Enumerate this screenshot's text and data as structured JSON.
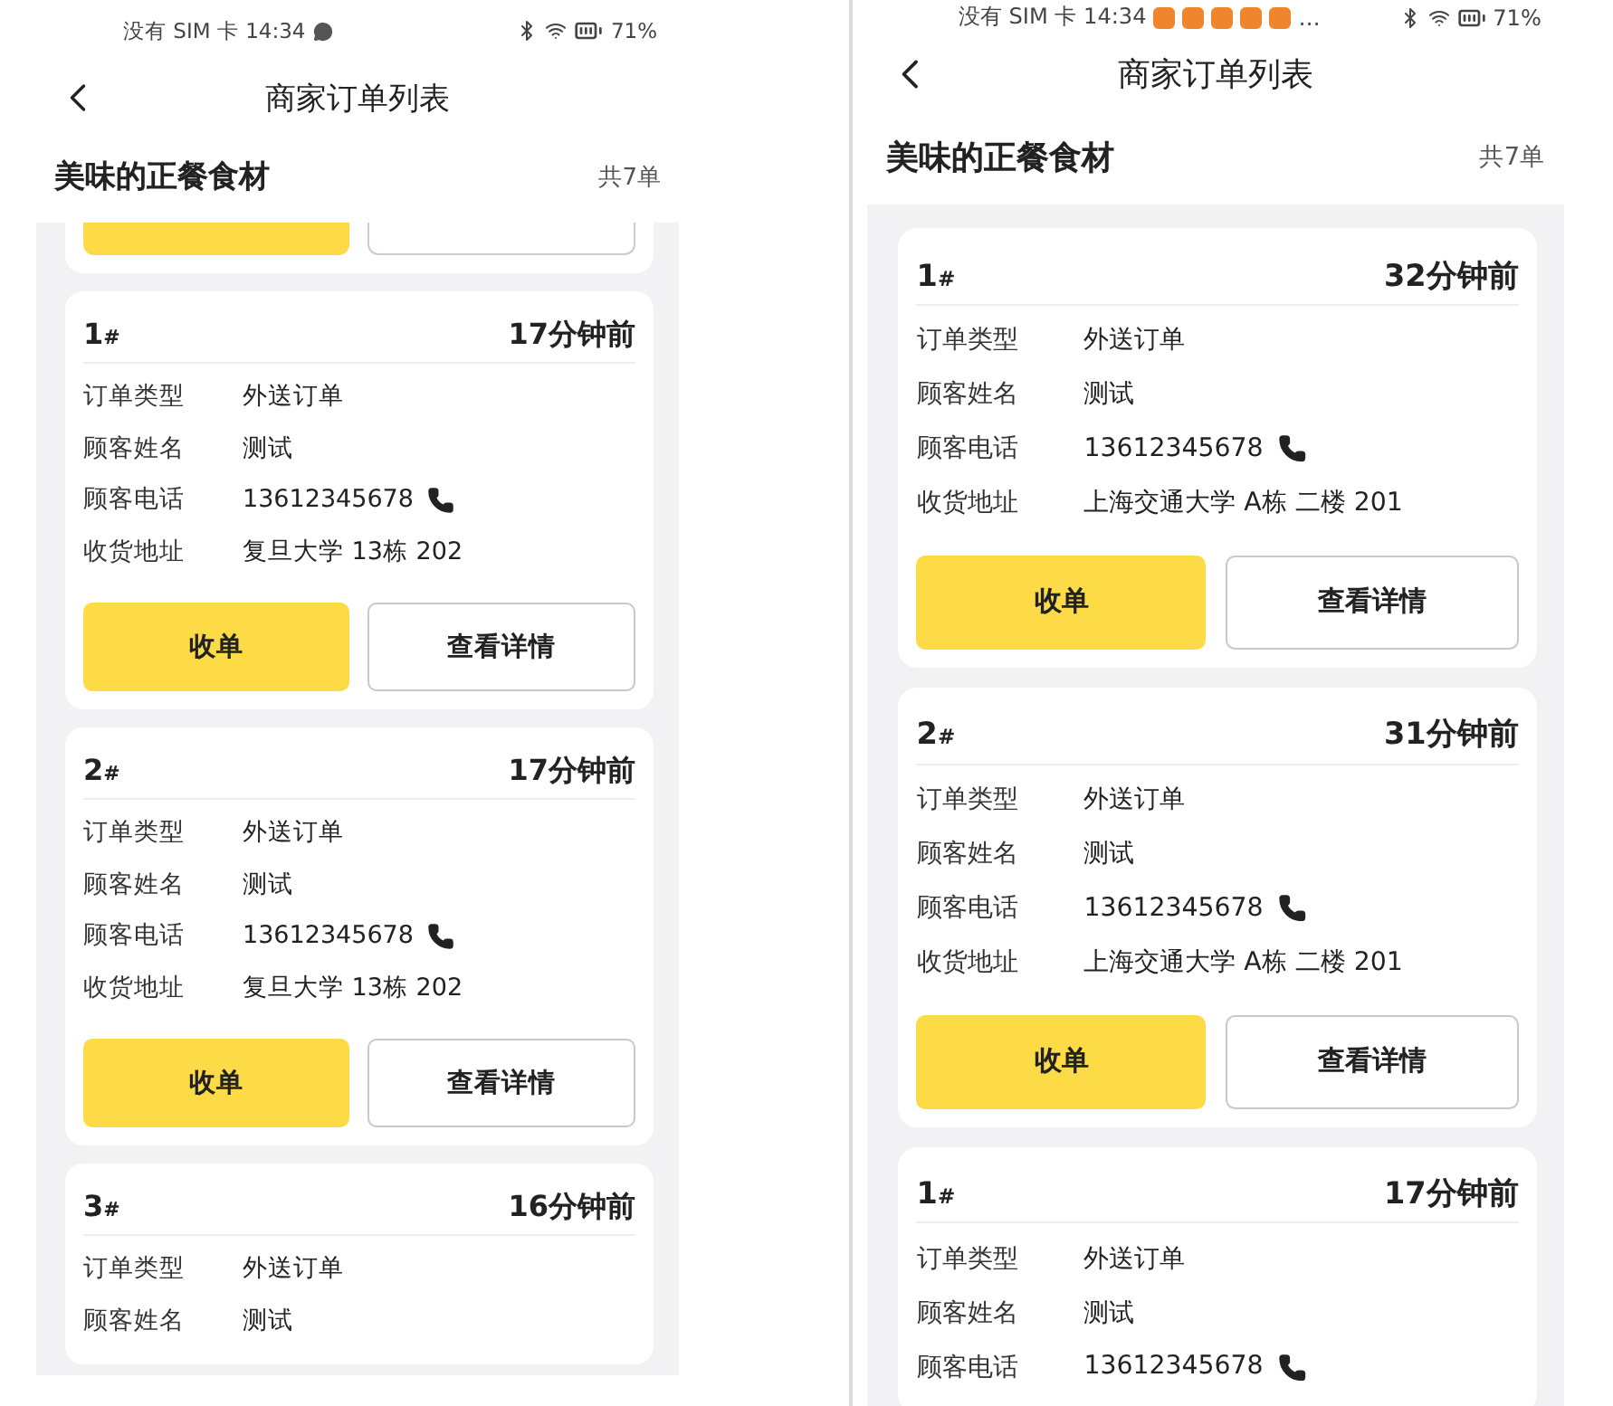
{
  "phones": [
    {
      "status_bar": {
        "text": "没有 SIM 卡 14:34",
        "notifications": [
          {
            "kind": "chat"
          }
        ],
        "battery": "71%"
      },
      "nav": {
        "title": "商家订单列表"
      },
      "shop": {
        "name": "美味的正餐食材",
        "count": "共7单"
      },
      "leading_fragment": true,
      "orders": [
        {
          "number": "1",
          "mark": "#",
          "time": "17分钟前",
          "rows": [
            {
              "label": "订单类型",
              "value": "外送订单",
              "kind": "text"
            },
            {
              "label": "顾客姓名",
              "value": "测试",
              "kind": "text"
            },
            {
              "label": "顾客电话",
              "value": "13612345678",
              "kind": "phone"
            },
            {
              "label": "收货地址",
              "value": "复旦大学 13栋 202",
              "kind": "text"
            }
          ],
          "buttons": [
            {
              "label": "收单",
              "kind": "primary"
            },
            {
              "label": "查看详情",
              "kind": "secondary"
            }
          ]
        },
        {
          "number": "2",
          "mark": "#",
          "time": "17分钟前",
          "rows": [
            {
              "label": "订单类型",
              "value": "外送订单",
              "kind": "text"
            },
            {
              "label": "顾客姓名",
              "value": "测试",
              "kind": "text"
            },
            {
              "label": "顾客电话",
              "value": "13612345678",
              "kind": "phone"
            },
            {
              "label": "收货地址",
              "value": "复旦大学 13栋 202",
              "kind": "text"
            }
          ],
          "buttons": [
            {
              "label": "收单",
              "kind": "primary"
            },
            {
              "label": "查看详情",
              "kind": "secondary"
            }
          ]
        },
        {
          "number": "3",
          "mark": "#",
          "time": "16分钟前",
          "rows": [
            {
              "label": "订单类型",
              "value": "外送订单",
              "kind": "text"
            },
            {
              "label": "顾客姓名",
              "value": "测试",
              "kind": "text"
            }
          ]
        }
      ]
    },
    {
      "status_bar": {
        "text": "没有 SIM 卡 14:34",
        "notifications": [
          {
            "kind": "app"
          },
          {
            "kind": "app"
          },
          {
            "kind": "app"
          },
          {
            "kind": "app"
          },
          {
            "kind": "app"
          }
        ],
        "overflow": "…",
        "battery": "71%"
      },
      "nav": {
        "title": "商家订单列表"
      },
      "shop": {
        "name": "美味的正餐食材",
        "count": "共7单"
      },
      "leading_fragment": false,
      "orders": [
        {
          "number": "1",
          "mark": "#",
          "time": "32分钟前",
          "rows": [
            {
              "label": "订单类型",
              "value": "外送订单",
              "kind": "text"
            },
            {
              "label": "顾客姓名",
              "value": "测试",
              "kind": "text"
            },
            {
              "label": "顾客电话",
              "value": "13612345678",
              "kind": "phone"
            },
            {
              "label": "收货地址",
              "value": "上海交通大学 A栋 二楼 201",
              "kind": "text"
            }
          ],
          "buttons": [
            {
              "label": "收单",
              "kind": "primary"
            },
            {
              "label": "查看详情",
              "kind": "secondary"
            }
          ]
        },
        {
          "number": "2",
          "mark": "#",
          "time": "31分钟前",
          "rows": [
            {
              "label": "订单类型",
              "value": "外送订单",
              "kind": "text"
            },
            {
              "label": "顾客姓名",
              "value": "测试",
              "kind": "text"
            },
            {
              "label": "顾客电话",
              "value": "13612345678",
              "kind": "phone"
            },
            {
              "label": "收货地址",
              "value": "上海交通大学 A栋 二楼 201",
              "kind": "text"
            }
          ],
          "buttons": [
            {
              "label": "收单",
              "kind": "primary"
            },
            {
              "label": "查看详情",
              "kind": "secondary"
            }
          ]
        },
        {
          "number": "1",
          "mark": "#",
          "time": "17分钟前",
          "rows": [
            {
              "label": "订单类型",
              "value": "外送订单",
              "kind": "text"
            },
            {
              "label": "顾客姓名",
              "value": "测试",
              "kind": "text"
            },
            {
              "label": "顾客电话",
              "value": "13612345678",
              "kind": "phone"
            }
          ]
        }
      ]
    }
  ]
}
